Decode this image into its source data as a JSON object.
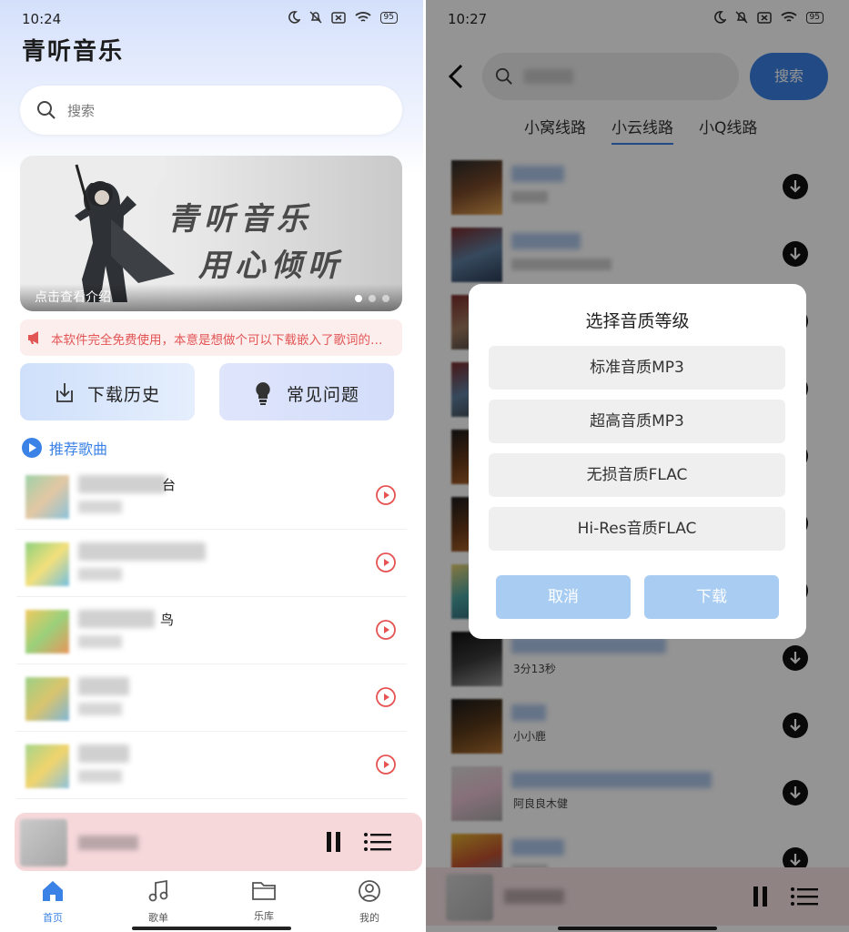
{
  "colors": {
    "accent": "#3b82e6",
    "notice_text": "#e25555",
    "play_icon": "#e55353",
    "player_bg": "#f6d8db"
  },
  "screen1": {
    "status": {
      "time": "10:24",
      "battery": "95"
    },
    "app_title": "青听音乐",
    "search_placeholder": "搜索",
    "banner": {
      "line1": "青听音乐",
      "line2": "用心倾听",
      "caption": "点击查看介绍",
      "dots": 3,
      "active_dot": 1
    },
    "notice": "本软件完全免费使用，本意是想做个可以下载嵌入了歌词的音乐软件",
    "quick_actions": [
      {
        "label": "下载历史",
        "icon": "download-icon"
      },
      {
        "label": "常见问题",
        "icon": "lightbulb-icon"
      }
    ],
    "recommend_title": "推荐歌曲",
    "songs": [
      {
        "visible_char": "台"
      },
      {
        "visible_char": ""
      },
      {
        "visible_char": "鸟"
      },
      {
        "visible_char": ""
      },
      {
        "visible_char": ""
      }
    ],
    "bottom_nav": [
      {
        "label": "首页",
        "icon": "home-icon",
        "active": true
      },
      {
        "label": "歌单",
        "icon": "music-note-icon",
        "active": false
      },
      {
        "label": "乐库",
        "icon": "folder-icon",
        "active": false
      },
      {
        "label": "我的",
        "icon": "user-icon",
        "active": false
      }
    ]
  },
  "screen2": {
    "status": {
      "time": "10:27",
      "battery": "95"
    },
    "search_button": "搜索",
    "tabs": [
      {
        "label": "小窝线路",
        "active": false
      },
      {
        "label": "小云线路",
        "active": true
      },
      {
        "label": "小Q线路",
        "active": false
      }
    ],
    "results": [
      {
        "artist": ""
      },
      {
        "artist": ""
      },
      {
        "artist": ""
      },
      {
        "artist": ""
      },
      {
        "artist": ""
      },
      {
        "artist": ""
      },
      {
        "artist": ""
      },
      {
        "artist": "3分13秒"
      },
      {
        "artist": "小小鹿"
      },
      {
        "artist": "阿良良木健"
      },
      {
        "artist": ""
      }
    ],
    "dialog": {
      "title": "选择音质等级",
      "options": [
        "标准音质MP3",
        "超高音质MP3",
        "无损音质FLAC",
        "Hi-Res音质FLAC"
      ],
      "cancel": "取消",
      "confirm": "下载"
    }
  }
}
